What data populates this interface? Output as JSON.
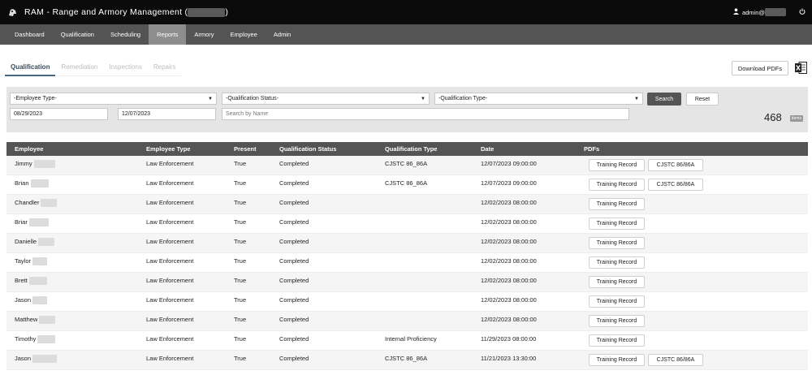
{
  "app": {
    "title": "RAM - Range and Armory Management (",
    "title_close": ")",
    "user_label": "admin@"
  },
  "nav": {
    "items": [
      {
        "label": "Dashboard",
        "active": false
      },
      {
        "label": "Qualification",
        "active": false
      },
      {
        "label": "Scheduling",
        "active": false
      },
      {
        "label": "Reports",
        "active": true
      },
      {
        "label": "Armory",
        "active": false
      },
      {
        "label": "Employee",
        "active": false
      },
      {
        "label": "Admin",
        "active": false
      }
    ]
  },
  "tabs": [
    {
      "label": "Qualification",
      "active": true
    },
    {
      "label": "Remediation",
      "active": false
    },
    {
      "label": "Inspections",
      "active": false
    },
    {
      "label": "Repairs",
      "active": false
    }
  ],
  "toolbar": {
    "download_label": "Download PDFs",
    "excel_icon": "excel-icon"
  },
  "filters": {
    "employee_type": "-Employee Type-",
    "qualification_status": "-Qualification Status-",
    "qualification_type": "-Qualification Type-",
    "search_label": "Search",
    "reset_label": "Reset",
    "start_date": "08/29/2023",
    "end_date": "12/07/2023",
    "name_placeholder": "Search by Name"
  },
  "results": {
    "count": "468",
    "items_label": "items"
  },
  "table": {
    "headers": [
      "Employee",
      "Employee Type",
      "Present",
      "Qualification Status",
      "Qualification Type",
      "Date",
      "PDFs"
    ],
    "rows": [
      {
        "employee": "Jimmy",
        "type": "Law Enforcement",
        "present": "True",
        "status": "Completed",
        "qual_type": "CJSTC 86_86A",
        "date": "12/07/2023 09:00:00",
        "pdfs": [
          "Training Record",
          "CJSTC 86/86A"
        ]
      },
      {
        "employee": "Brian",
        "type": "Law Enforcement",
        "present": "True",
        "status": "Completed",
        "qual_type": "CJSTC 86_86A",
        "date": "12/07/2023 09:00:00",
        "pdfs": [
          "Training Record",
          "CJSTC 86/86A"
        ]
      },
      {
        "employee": "Chandler",
        "type": "Law Enforcement",
        "present": "True",
        "status": "Completed",
        "qual_type": "",
        "date": "12/02/2023 08:00:00",
        "pdfs": [
          "Training Record"
        ]
      },
      {
        "employee": "Briar",
        "type": "Law Enforcement",
        "present": "True",
        "status": "Completed",
        "qual_type": "",
        "date": "12/02/2023 08:00:00",
        "pdfs": [
          "Training Record"
        ]
      },
      {
        "employee": "Danielle",
        "type": "Law Enforcement",
        "present": "True",
        "status": "Completed",
        "qual_type": "",
        "date": "12/02/2023 08:00:00",
        "pdfs": [
          "Training Record"
        ]
      },
      {
        "employee": "Taylor",
        "type": "Law Enforcement",
        "present": "True",
        "status": "Completed",
        "qual_type": "",
        "date": "12/02/2023 08:00:00",
        "pdfs": [
          "Training Record"
        ]
      },
      {
        "employee": "Brett",
        "type": "Law Enforcement",
        "present": "True",
        "status": "Completed",
        "qual_type": "",
        "date": "12/02/2023 08:00:00",
        "pdfs": [
          "Training Record"
        ]
      },
      {
        "employee": "Jason",
        "type": "Law Enforcement",
        "present": "True",
        "status": "Completed",
        "qual_type": "",
        "date": "12/02/2023 08:00:00",
        "pdfs": [
          "Training Record"
        ]
      },
      {
        "employee": "Matthew",
        "type": "Law Enforcement",
        "present": "True",
        "status": "Completed",
        "qual_type": "",
        "date": "12/02/2023 08:00:00",
        "pdfs": [
          "Training Record"
        ]
      },
      {
        "employee": "Timothy",
        "type": "Law Enforcement",
        "present": "True",
        "status": "Completed",
        "qual_type": "Internal Proficiency",
        "date": "11/29/2023 08:00:00",
        "pdfs": [
          "Training Record"
        ]
      },
      {
        "employee": "Jason",
        "type": "Law Enforcement",
        "present": "True",
        "status": "Completed",
        "qual_type": "CJSTC 86_86A",
        "date": "11/21/2023 13:30:00",
        "pdfs": [
          "Training Record",
          "CJSTC 86/86A"
        ]
      }
    ]
  }
}
